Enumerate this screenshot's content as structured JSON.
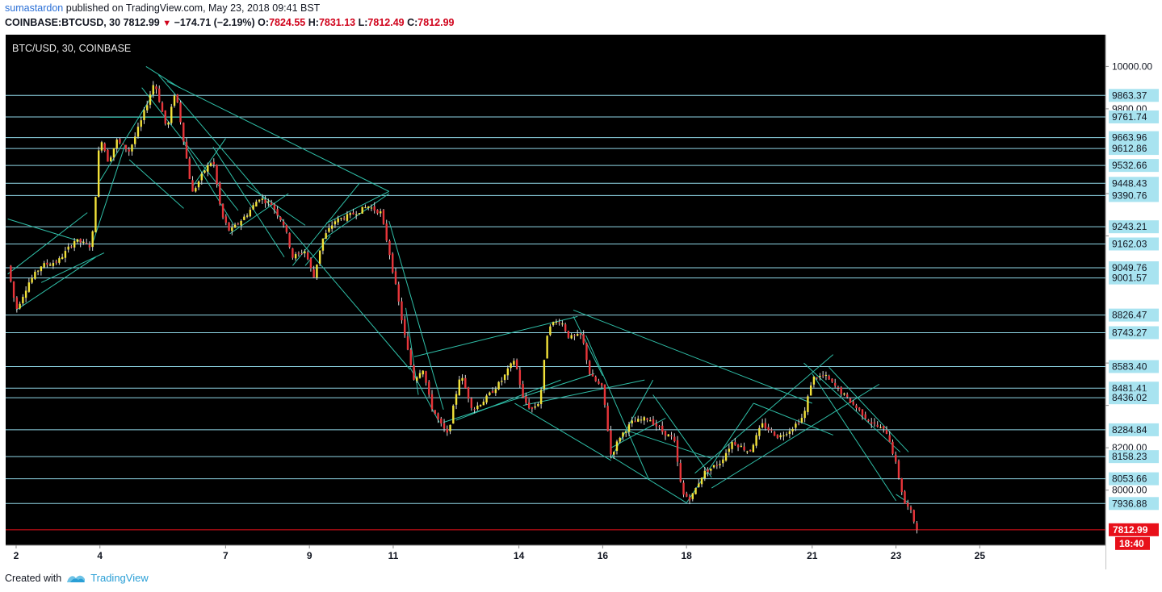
{
  "header": {
    "author": "sumastardon",
    "published_text": "published on TradingView.com, May 23, 2018 09:41 BST",
    "symbol": "COINBASE:BTCUSD, 30",
    "last": "7812.99",
    "change": "−174.71 (−2.19%)",
    "o_label": "O:",
    "o": "7824.55",
    "h_label": "H:",
    "h": "7831.13",
    "l_label": "L:",
    "l": "7812.49",
    "c_label": "C:",
    "c": "7812.99"
  },
  "footer": {
    "created_with": "Created with",
    "brand": "TradingView"
  },
  "colors": {
    "background": "#000000",
    "level_line": "#8fd6e6",
    "trend_line": "#2fbfa8",
    "label_bg": "#a8e3f0",
    "up": "#f2e23a",
    "down": "#e8353a",
    "price_tag": "#e8101a"
  },
  "chart_data": {
    "type": "candlestick",
    "title": "BTC/USD, 30, COINBASE",
    "scale": "linear",
    "ylim": [
      7740,
      10150
    ],
    "xlim": [
      1.75,
      28.0
    ],
    "x_ticks": [
      2,
      4,
      7,
      9,
      11,
      14,
      16,
      18,
      21,
      23,
      25
    ],
    "y_ticks": [
      10000.0,
      9800.0,
      9400.0,
      9200.0,
      8600.0,
      8400.0,
      8200.0,
      8000.0
    ],
    "axis_level_labels": [
      "10000.00",
      "9800.00",
      "8200.00",
      "8000.00"
    ],
    "price_levels": [
      9863.37,
      9761.74,
      9663.96,
      9612.86,
      9532.66,
      9448.43,
      9390.76,
      9243.21,
      9162.03,
      9049.76,
      9001.57,
      8826.47,
      8743.27,
      8583.4,
      8481.41,
      8436.02,
      8284.84,
      8158.23,
      8053.66,
      7936.88
    ],
    "last_price": 7812.99,
    "countdown": "18:40",
    "price_path": [
      [
        1.8,
        9060
      ],
      [
        2.0,
        8850
      ],
      [
        2.3,
        8980
      ],
      [
        2.6,
        9060
      ],
      [
        3.0,
        9080
      ],
      [
        3.4,
        9180
      ],
      [
        3.8,
        9150
      ],
      [
        3.9,
        9400
      ],
      [
        4.0,
        9680
      ],
      [
        4.2,
        9550
      ],
      [
        4.4,
        9650
      ],
      [
        4.7,
        9600
      ],
      [
        5.0,
        9750
      ],
      [
        5.3,
        9930
      ],
      [
        5.6,
        9700
      ],
      [
        5.8,
        9890
      ],
      [
        6.0,
        9650
      ],
      [
        6.2,
        9400
      ],
      [
        6.5,
        9510
      ],
      [
        6.7,
        9560
      ],
      [
        6.9,
        9300
      ],
      [
        7.1,
        9220
      ],
      [
        7.5,
        9300
      ],
      [
        7.8,
        9380
      ],
      [
        8.1,
        9350
      ],
      [
        8.4,
        9250
      ],
      [
        8.6,
        9100
      ],
      [
        8.9,
        9130
      ],
      [
        9.1,
        9000
      ],
      [
        9.3,
        9180
      ],
      [
        9.6,
        9270
      ],
      [
        10.0,
        9300
      ],
      [
        10.4,
        9340
      ],
      [
        10.7,
        9310
      ],
      [
        10.9,
        9130
      ],
      [
        11.1,
        8920
      ],
      [
        11.3,
        8700
      ],
      [
        11.5,
        8520
      ],
      [
        11.7,
        8580
      ],
      [
        11.9,
        8400
      ],
      [
        12.1,
        8320
      ],
      [
        12.3,
        8260
      ],
      [
        12.6,
        8550
      ],
      [
        12.9,
        8380
      ],
      [
        13.2,
        8430
      ],
      [
        13.6,
        8520
      ],
      [
        13.9,
        8620
      ],
      [
        14.1,
        8430
      ],
      [
        14.3,
        8380
      ],
      [
        14.5,
        8420
      ],
      [
        14.7,
        8780
      ],
      [
        15.0,
        8800
      ],
      [
        15.2,
        8720
      ],
      [
        15.5,
        8730
      ],
      [
        15.7,
        8540
      ],
      [
        16.0,
        8480
      ],
      [
        16.2,
        8160
      ],
      [
        16.4,
        8250
      ],
      [
        16.7,
        8320
      ],
      [
        17.1,
        8340
      ],
      [
        17.4,
        8280
      ],
      [
        17.7,
        8240
      ],
      [
        17.9,
        7980
      ],
      [
        18.1,
        7960
      ],
      [
        18.4,
        8080
      ],
      [
        18.8,
        8130
      ],
      [
        19.1,
        8230
      ],
      [
        19.5,
        8180
      ],
      [
        19.8,
        8310
      ],
      [
        20.2,
        8250
      ],
      [
        20.5,
        8290
      ],
      [
        20.8,
        8350
      ],
      [
        21.0,
        8530
      ],
      [
        21.3,
        8540
      ],
      [
        21.6,
        8480
      ],
      [
        22.0,
        8400
      ],
      [
        22.4,
        8320
      ],
      [
        22.8,
        8270
      ],
      [
        23.0,
        8120
      ],
      [
        23.2,
        7940
      ],
      [
        23.35,
        7900
      ],
      [
        23.5,
        7812.99
      ]
    ],
    "trend_lines": [
      [
        [
          1.8,
          9280
        ],
        [
          3.6,
          9170
        ]
      ],
      [
        [
          1.8,
          9020
        ],
        [
          3.7,
          9310
        ]
      ],
      [
        [
          2.0,
          8850
        ],
        [
          3.9,
          9100
        ]
      ],
      [
        [
          2.6,
          8980
        ],
        [
          4.1,
          9120
        ]
      ],
      [
        [
          3.8,
          9150
        ],
        [
          4.6,
          9630
        ]
      ],
      [
        [
          4.0,
          9460
        ],
        [
          5.3,
          9880
        ]
      ],
      [
        [
          4.0,
          9760
        ],
        [
          6.3,
          9760
        ]
      ],
      [
        [
          5.1,
          10000
        ],
        [
          5.9,
          9900
        ]
      ],
      [
        [
          4.7,
          9560
        ],
        [
          6.0,
          9330
        ]
      ],
      [
        [
          5.4,
          9960
        ],
        [
          11.4,
          8570
        ]
      ],
      [
        [
          5.6,
          9930
        ],
        [
          10.9,
          9410
        ]
      ],
      [
        [
          6.2,
          9430
        ],
        [
          7.0,
          9660
        ]
      ],
      [
        [
          5.0,
          9900
        ],
        [
          7.3,
          9320
        ]
      ],
      [
        [
          6.7,
          9620
        ],
        [
          8.4,
          9100
        ]
      ],
      [
        [
          6.0,
          9640
        ],
        [
          7.2,
          9250
        ]
      ],
      [
        [
          7.1,
          9210
        ],
        [
          8.5,
          9400
        ]
      ],
      [
        [
          7.5,
          9440
        ],
        [
          8.9,
          9250
        ]
      ],
      [
        [
          8.9,
          9060
        ],
        [
          9.5,
          9200
        ]
      ],
      [
        [
          8.6,
          9060
        ],
        [
          10.2,
          9450
        ]
      ],
      [
        [
          9.3,
          9180
        ],
        [
          10.9,
          9400
        ]
      ],
      [
        [
          9.4,
          9260
        ],
        [
          10.9,
          9410
        ]
      ],
      [
        [
          10.9,
          9270
        ],
        [
          12.2,
          8380
        ]
      ],
      [
        [
          11.3,
          8860
        ],
        [
          11.6,
          8450
        ]
      ],
      [
        [
          11.4,
          8580
        ],
        [
          12.1,
          8320
        ]
      ],
      [
        [
          11.5,
          8630
        ],
        [
          15.4,
          8820
        ]
      ],
      [
        [
          12.2,
          8320
        ],
        [
          15.8,
          8550
        ]
      ],
      [
        [
          12.5,
          8330
        ],
        [
          15.0,
          8520
        ]
      ],
      [
        [
          13.9,
          8410
        ],
        [
          16.2,
          8140
        ]
      ],
      [
        [
          14.1,
          8400
        ],
        [
          17.0,
          8520
        ]
      ],
      [
        [
          15.3,
          8820
        ],
        [
          16.0,
          8540
        ]
      ],
      [
        [
          15.3,
          8850
        ],
        [
          21.0,
          8410
        ]
      ],
      [
        [
          15.6,
          8730
        ],
        [
          17.1,
          8050
        ]
      ],
      [
        [
          16.2,
          8160
        ],
        [
          18.0,
          7940
        ]
      ],
      [
        [
          16.2,
          8150
        ],
        [
          17.2,
          8520
        ]
      ],
      [
        [
          16.2,
          8200
        ],
        [
          17.5,
          8340
        ]
      ],
      [
        [
          16.6,
          8280
        ],
        [
          18.6,
          8150
        ]
      ],
      [
        [
          17.2,
          8450
        ],
        [
          18.6,
          8060
        ]
      ],
      [
        [
          18.0,
          7940
        ],
        [
          19.6,
          8410
        ]
      ],
      [
        [
          18.2,
          8080
        ],
        [
          21.5,
          8640
        ]
      ],
      [
        [
          18.6,
          8010
        ],
        [
          22.6,
          8500
        ]
      ],
      [
        [
          19.6,
          8410
        ],
        [
          21.5,
          8260
        ]
      ],
      [
        [
          20.8,
          8600
        ],
        [
          23.1,
          8180
        ]
      ],
      [
        [
          21.0,
          8550
        ],
        [
          23.0,
          7950
        ]
      ],
      [
        [
          21.4,
          8580
        ],
        [
          23.3,
          8180
        ]
      ],
      [
        [
          23.0,
          7980
        ],
        [
          23.3,
          7940
        ]
      ]
    ]
  }
}
